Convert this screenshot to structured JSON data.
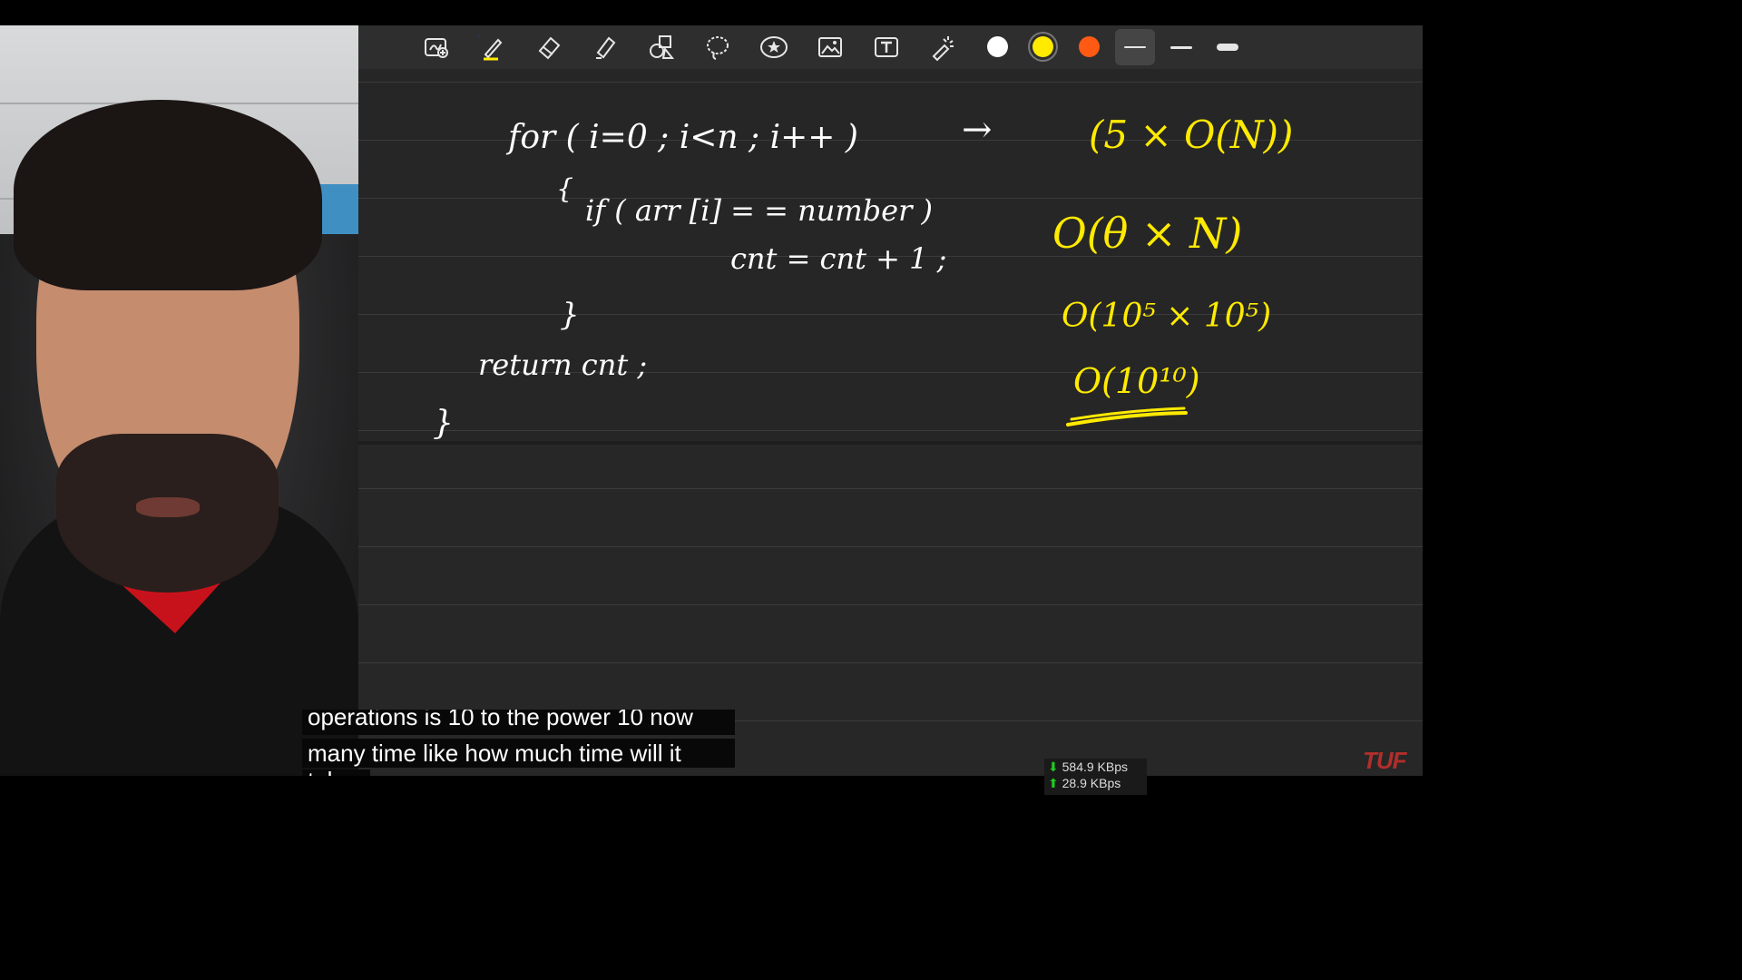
{
  "toolbar": {
    "tools": [
      {
        "name": "page-add-icon",
        "label": "Add page"
      },
      {
        "name": "pen-icon",
        "label": "Pen"
      },
      {
        "name": "eraser-icon",
        "label": "Eraser"
      },
      {
        "name": "highlighter-icon",
        "label": "Highlighter"
      },
      {
        "name": "shapes-icon",
        "label": "Shapes"
      },
      {
        "name": "lasso-icon",
        "label": "Lasso"
      },
      {
        "name": "sticker-icon",
        "label": "Sticker"
      },
      {
        "name": "image-icon",
        "label": "Image"
      },
      {
        "name": "text-icon",
        "label": "Text"
      },
      {
        "name": "laser-pointer-icon",
        "label": "Laser pointer"
      }
    ],
    "colors": [
      "#ffffff",
      "#ffea00",
      "#ff5a14"
    ],
    "selected_color": "#ffea00",
    "thickness_options": [
      "thin",
      "medium",
      "thick"
    ],
    "selected_thickness": "thin"
  },
  "notes": {
    "code_lines": [
      "for ( i=0 ; i<n ; i++ )",
      "{",
      "if ( arr [i] = = number )",
      "cnt = cnt + 1 ;",
      "}",
      "return cnt ;",
      "}"
    ],
    "arrow": "→",
    "complexity_lines": [
      "(5 × O(N))",
      "O(θ × N)",
      "O(10⁵ × 10⁵)",
      "O(10¹⁰)"
    ],
    "ink_color": "#ffffff",
    "highlight_color": "#ffea00"
  },
  "captions": {
    "line0": "operations is 10 to the power 10 now",
    "line1": "many time like how much time will it",
    "line2": "take"
  },
  "network": {
    "download": "584.9 KBps",
    "upload": "28.9 KBps"
  },
  "brand": {
    "logo_text": "TUF"
  }
}
